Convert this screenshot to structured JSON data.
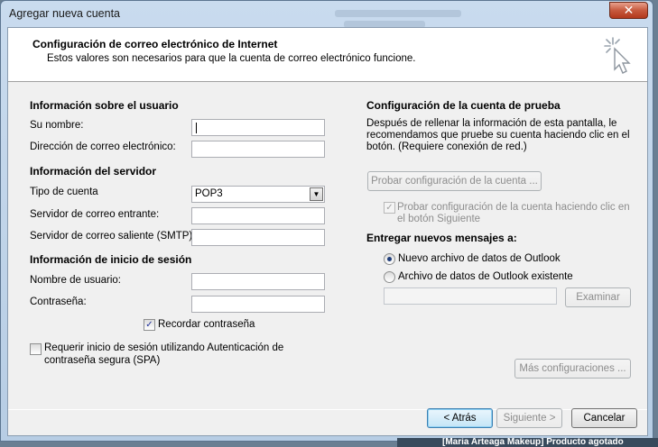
{
  "window": {
    "title": "Agregar nueva cuenta",
    "close_symbol": "✕"
  },
  "header": {
    "title": "Configuración de correo electrónico de Internet",
    "subtitle": "Estos valores son necesarios para que la cuenta de correo electrónico funcione.",
    "icon": "cursor-sparkle-icon"
  },
  "user_info": {
    "heading": "Información sobre el usuario",
    "name_label": "Su nombre:",
    "name_value": "",
    "email_label": "Dirección de correo electrónico:",
    "email_value": ""
  },
  "server_info": {
    "heading": "Información del servidor",
    "account_type_label": "Tipo de cuenta",
    "account_type_value": "POP3",
    "incoming_label": "Servidor de correo entrante:",
    "incoming_value": "",
    "outgoing_label": "Servidor de correo saliente (SMTP):",
    "outgoing_value": ""
  },
  "login_info": {
    "heading": "Información de inicio de sesión",
    "username_label": "Nombre de usuario:",
    "username_value": "",
    "password_label": "Contraseña:",
    "password_value": "",
    "remember_label": "Recordar contraseña",
    "remember_checked": true,
    "spa_label_line1": "Requerir inicio de sesión utilizando Autenticación de",
    "spa_label_line2": "contraseña segura (SPA)",
    "spa_checked": false
  },
  "test_settings": {
    "heading": "Configuración de la cuenta de prueba",
    "desc_line1": "Después de rellenar la información de esta pantalla, le",
    "desc_line2": "recomendamos que pruebe su cuenta haciendo clic en el",
    "desc_line3": "botón. (Requiere conexión de red.)",
    "test_button": "Probar configuración de la cuenta ...",
    "auto_test_line1": "Probar configuración de la cuenta haciendo clic en",
    "auto_test_line2": "el botón Siguiente",
    "auto_test_checked": true
  },
  "delivery": {
    "heading": "Entregar nuevos mensajes a:",
    "option_new": "Nuevo archivo de datos de Outlook",
    "option_existing": "Archivo de datos de Outlook existente",
    "selected": "new",
    "path_value": "",
    "browse_button": "Examinar"
  },
  "more_settings_button": "Más configuraciones ...",
  "footer": {
    "back": "< Atrás",
    "next": "Siguiente >",
    "cancel": "Cancelar"
  },
  "taskbar_text": "[Maria Arteaga Makeup] Producto agotado"
}
